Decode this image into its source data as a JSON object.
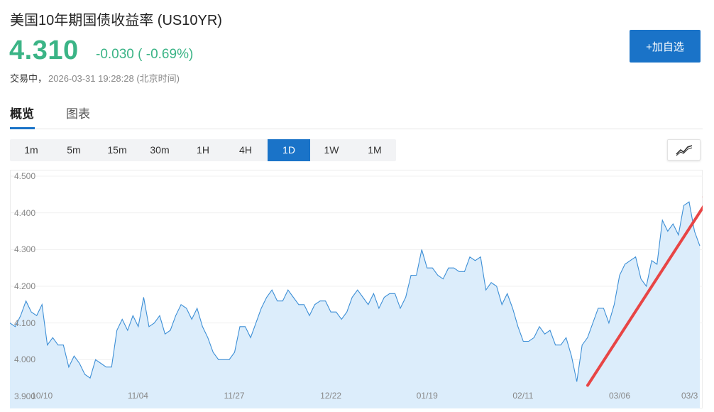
{
  "header": {
    "title": "美国10年期国债收益率 (US10YR)",
    "price": "4.310",
    "change": "-0.030 ( -0.69%)",
    "status": "交易中，",
    "timestamp": "2026-03-31 19:28:28 (北京时间)",
    "add_button_label": "+加自选"
  },
  "tabs": [
    {
      "label": "概览",
      "active": true
    },
    {
      "label": "图表",
      "active": false
    }
  ],
  "intervals": [
    {
      "label": "1m",
      "active": false
    },
    {
      "label": "5m",
      "active": false
    },
    {
      "label": "15m",
      "active": false
    },
    {
      "label": "30m",
      "active": false
    },
    {
      "label": "1H",
      "active": false
    },
    {
      "label": "4H",
      "active": false
    },
    {
      "label": "1D",
      "active": true
    },
    {
      "label": "1W",
      "active": false
    },
    {
      "label": "1M",
      "active": false
    }
  ],
  "chart_type_icon": "line-chart-icon",
  "colors": {
    "up_green": "#3bb486",
    "accent_blue": "#1a73c8",
    "line": "#3d8fd6",
    "area_fill": "#dcedfb",
    "arrow": "#e84545"
  },
  "chart_data": {
    "type": "area",
    "ylim": [
      3.9,
      4.5
    ],
    "y_ticks": [
      "4.500",
      "4.400",
      "4.300",
      "4.200",
      "4.100",
      "4.000",
      "3.900"
    ],
    "x_ticks": [
      "10/10",
      "11/04",
      "11/27",
      "12/22",
      "01/19",
      "02/11",
      "03/06",
      "03/3"
    ],
    "x_tick_index": [
      6,
      24,
      42,
      60,
      78,
      96,
      114,
      132
    ],
    "values": [
      4.1,
      4.09,
      4.12,
      4.16,
      4.13,
      4.12,
      4.15,
      4.04,
      4.06,
      4.04,
      4.04,
      3.98,
      4.01,
      3.99,
      3.96,
      3.95,
      4.0,
      3.99,
      3.98,
      3.98,
      4.08,
      4.11,
      4.08,
      4.12,
      4.09,
      4.17,
      4.09,
      4.1,
      4.12,
      4.07,
      4.08,
      4.12,
      4.15,
      4.14,
      4.11,
      4.14,
      4.09,
      4.06,
      4.02,
      4.0,
      4.0,
      4.0,
      4.02,
      4.09,
      4.09,
      4.06,
      4.1,
      4.14,
      4.17,
      4.19,
      4.16,
      4.16,
      4.19,
      4.17,
      4.15,
      4.15,
      4.12,
      4.15,
      4.16,
      4.16,
      4.13,
      4.13,
      4.11,
      4.13,
      4.17,
      4.19,
      4.17,
      4.15,
      4.18,
      4.14,
      4.17,
      4.18,
      4.18,
      4.14,
      4.17,
      4.23,
      4.23,
      4.3,
      4.25,
      4.25,
      4.23,
      4.22,
      4.25,
      4.25,
      4.24,
      4.24,
      4.28,
      4.27,
      4.28,
      4.19,
      4.21,
      4.2,
      4.15,
      4.18,
      4.14,
      4.09,
      4.05,
      4.05,
      4.06,
      4.09,
      4.07,
      4.08,
      4.04,
      4.04,
      4.06,
      4.01,
      3.94,
      4.04,
      4.06,
      4.1,
      4.14,
      4.14,
      4.1,
      4.15,
      4.23,
      4.26,
      4.27,
      4.28,
      4.22,
      4.2,
      4.27,
      4.26,
      4.38,
      4.35,
      4.37,
      4.34,
      4.42,
      4.43,
      4.35,
      4.31
    ],
    "annotation": {
      "type": "arrow",
      "from": [
        114,
        3.93
      ],
      "to": [
        138,
        4.47
      ]
    }
  }
}
